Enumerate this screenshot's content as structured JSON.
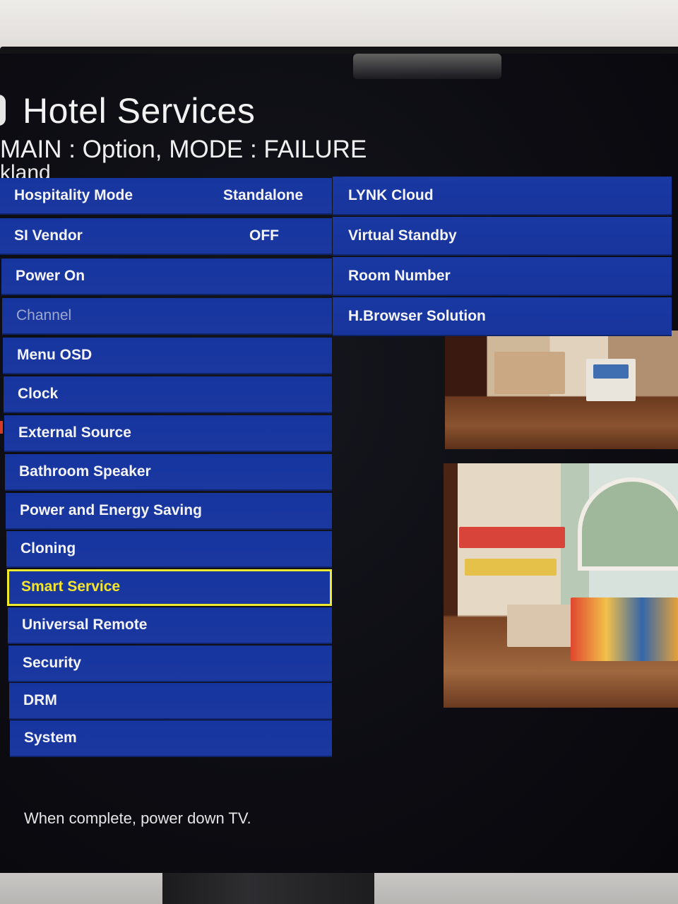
{
  "header": {
    "title": "Hotel Services",
    "subtitle": "MAIN : Option, MODE : FAILURE",
    "peek_text": "kland"
  },
  "left_menu": [
    {
      "label": "Hospitality Mode",
      "value": "Standalone",
      "state": "normal"
    },
    {
      "label": "SI Vendor",
      "value": "OFF",
      "state": "normal"
    },
    {
      "label": "Power On",
      "value": "",
      "state": "normal"
    },
    {
      "label": "Channel",
      "value": "",
      "state": "disabled"
    },
    {
      "label": "Menu OSD",
      "value": "",
      "state": "normal"
    },
    {
      "label": "Clock",
      "value": "",
      "state": "normal"
    },
    {
      "label": "External Source",
      "value": "",
      "state": "normal"
    },
    {
      "label": "Bathroom Speaker",
      "value": "",
      "state": "normal"
    },
    {
      "label": "Power and Energy Saving",
      "value": "",
      "state": "normal"
    },
    {
      "label": "Cloning",
      "value": "",
      "state": "normal"
    },
    {
      "label": "Smart Service",
      "value": "",
      "state": "selected"
    },
    {
      "label": "Universal Remote",
      "value": "",
      "state": "normal"
    },
    {
      "label": "Security",
      "value": "",
      "state": "normal"
    },
    {
      "label": "DRM",
      "value": "",
      "state": "normal"
    },
    {
      "label": "System",
      "value": "",
      "state": "normal"
    }
  ],
  "right_menu": [
    {
      "label": "LYNK Cloud"
    },
    {
      "label": "Virtual Standby"
    },
    {
      "label": "Room Number"
    },
    {
      "label": "H.Browser Solution"
    }
  ],
  "footer": {
    "hint": "When complete, power down TV."
  },
  "colors": {
    "menu_blue": "#17359f",
    "selection_yellow": "#f0ea2e",
    "screen_bg": "#0c0c12"
  }
}
